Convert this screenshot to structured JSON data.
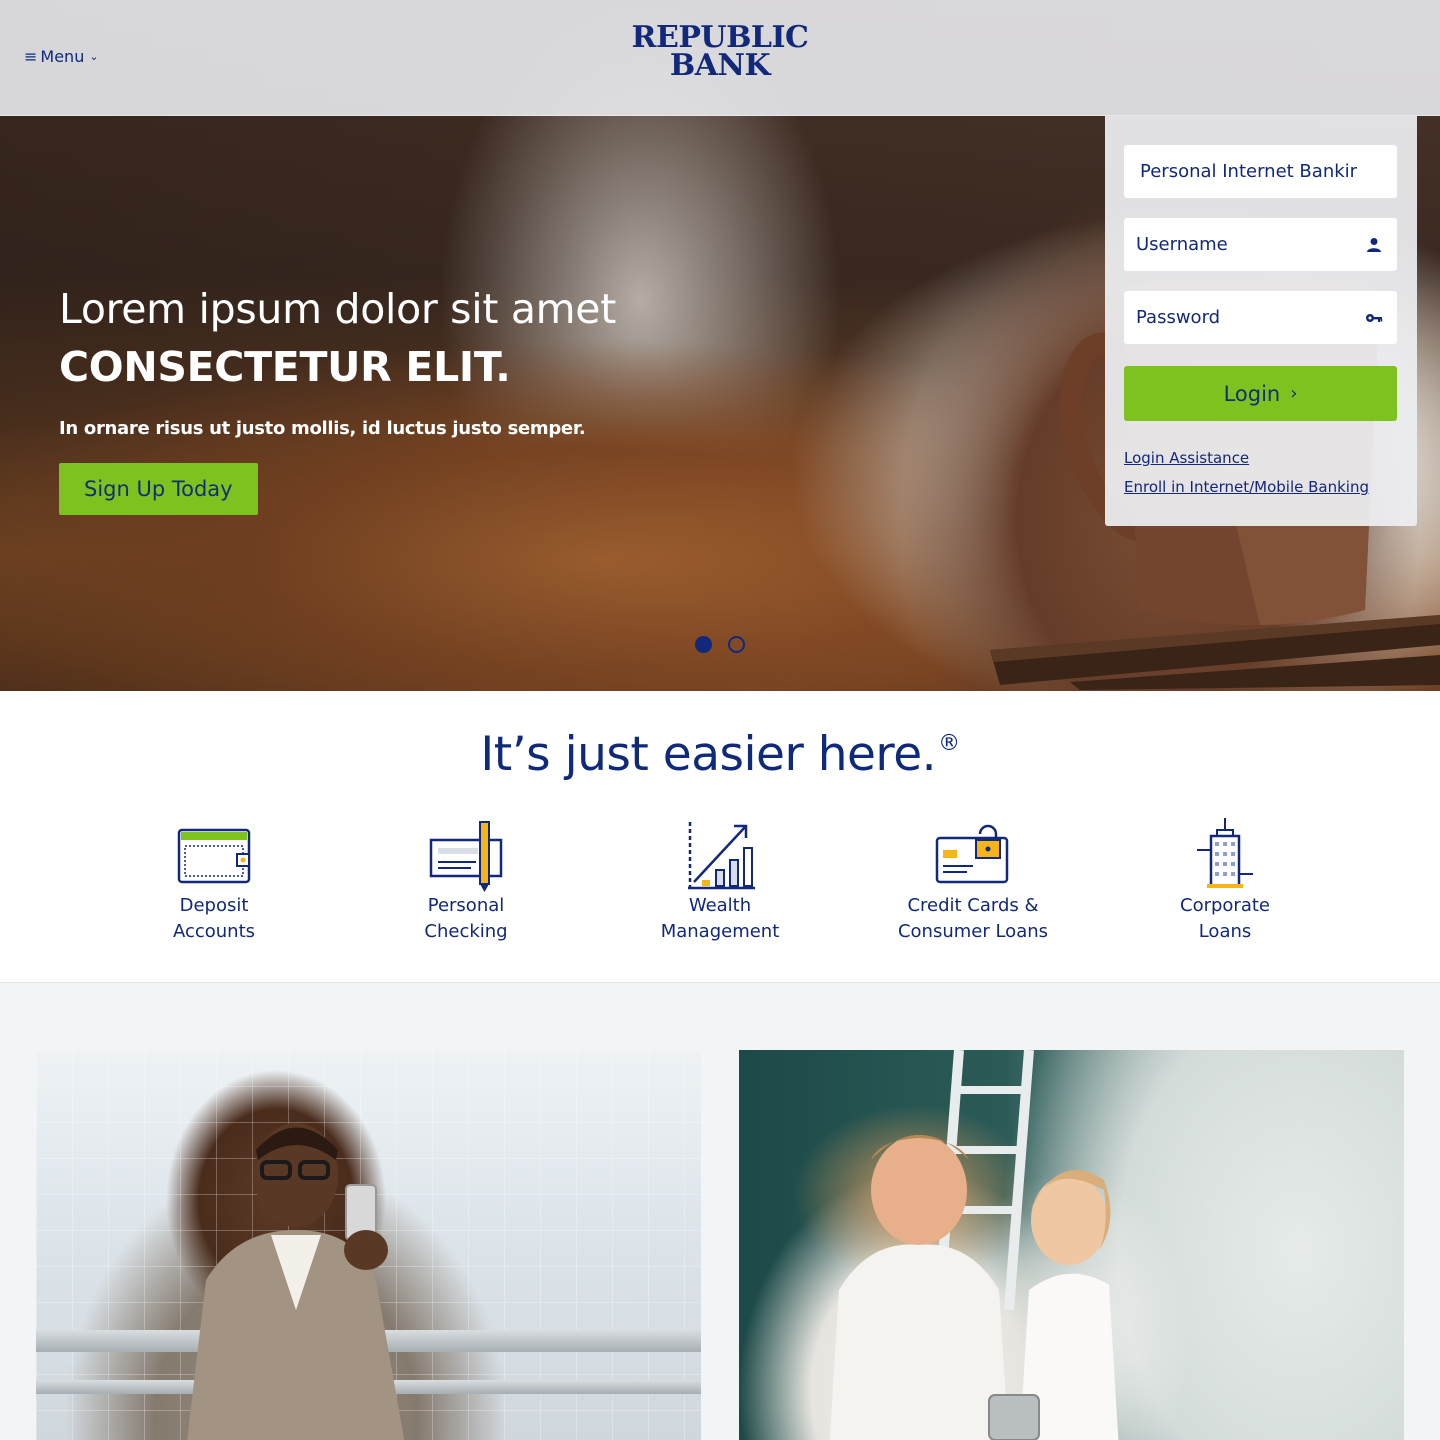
{
  "header": {
    "menu_label": "Menu",
    "logo_line1": "REPUBLIC",
    "logo_line2": "BANK"
  },
  "hero": {
    "title_line1": "Lorem ipsum dolor sit amet",
    "title_line2": "CONSECTETUR ELIT.",
    "subtitle": "In ornare risus ut justo mollis, id luctus justo semper.",
    "cta_label": "Sign Up Today",
    "carousel": {
      "slides": 2,
      "active": 1
    }
  },
  "login": {
    "account_type": "Personal Internet Bankir",
    "username_placeholder": "Username",
    "password_placeholder": "Password",
    "login_label": "Login",
    "links": [
      "Login Assistance",
      "Enroll in Internet/Mobile Banking"
    ]
  },
  "tagline": {
    "text": "It’s just easier here.",
    "mark": "®"
  },
  "categories": [
    {
      "line1": "Deposit",
      "line2": "Accounts",
      "icon": "wallet-icon"
    },
    {
      "line1": "Personal",
      "line2": "Checking",
      "icon": "check-pen-icon"
    },
    {
      "line1": "Wealth",
      "line2": "Management",
      "icon": "growth-chart-icon"
    },
    {
      "line1": "Credit Cards &",
      "line2": "Consumer Loans",
      "icon": "credit-card-lock-icon"
    },
    {
      "line1": "Corporate",
      "line2": "Loans",
      "icon": "building-icon"
    }
  ],
  "colors": {
    "navy": "#12287a",
    "green": "#7dc21e"
  }
}
